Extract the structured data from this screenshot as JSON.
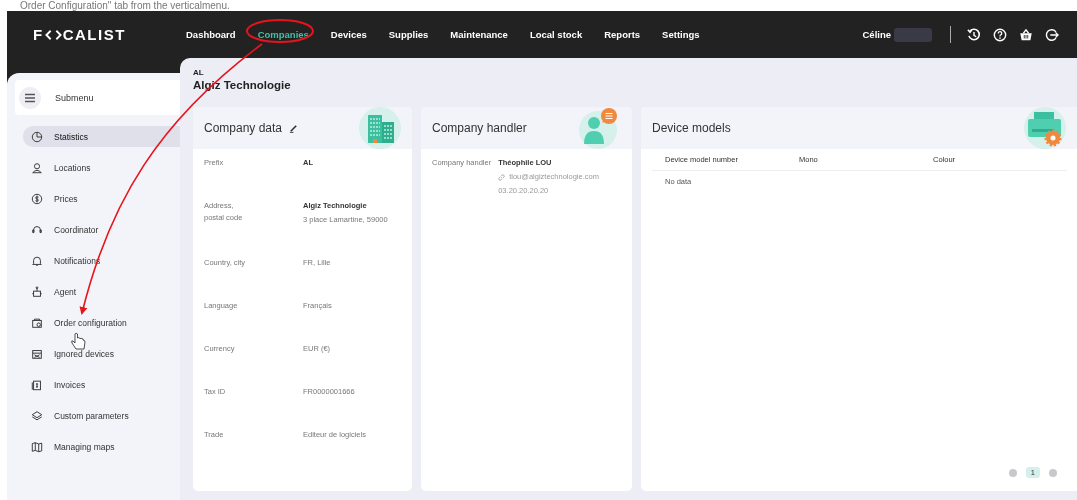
{
  "caption": "Order Configuration\" tab from the verticalmenu.",
  "topbar": {
    "logo_text": [
      "F",
      "CALIST"
    ],
    "nav": [
      {
        "label": "Dashboard",
        "selected": false
      },
      {
        "label": "Companies",
        "selected": true
      },
      {
        "label": "Devices",
        "selected": false
      },
      {
        "label": "Supplies",
        "selected": false
      },
      {
        "label": "Maintenance",
        "selected": false
      },
      {
        "label": "Local stock",
        "selected": false
      },
      {
        "label": "Reports",
        "selected": false
      },
      {
        "label": "Settings",
        "selected": false
      }
    ],
    "user": "Céline"
  },
  "sidebar": {
    "title": "Submenu",
    "items": [
      {
        "label": "Statistics",
        "selected": true
      },
      {
        "label": "Locations",
        "selected": false
      },
      {
        "label": "Prices",
        "selected": false
      },
      {
        "label": "Coordinator",
        "selected": false
      },
      {
        "label": "Notifications",
        "selected": false
      },
      {
        "label": "Agent",
        "selected": false
      },
      {
        "label": "Order configuration",
        "selected": false
      },
      {
        "label": "Ignored devices",
        "selected": false
      },
      {
        "label": "Invoices",
        "selected": false
      },
      {
        "label": "Custom parameters",
        "selected": false
      },
      {
        "label": "Managing maps",
        "selected": false
      }
    ]
  },
  "company": {
    "prefix": "AL",
    "name": "Algiz Technologie"
  },
  "company_data": {
    "title": "Company data",
    "rows": [
      {
        "label": "Prefix",
        "values": [
          {
            "text": "AL",
            "bold": true
          }
        ]
      },
      {
        "label": "Address,\npostal code",
        "values": [
          {
            "text": "Algiz Technologie",
            "bold": true
          },
          {
            "text": "3 place Lamartine, 59000",
            "bold": false
          }
        ]
      },
      {
        "label": "Country, city",
        "values": [
          {
            "text": "FR, Lille",
            "bold": false
          }
        ]
      },
      {
        "label": "Language",
        "values": [
          {
            "text": "Français",
            "bold": false
          }
        ]
      },
      {
        "label": "Currency",
        "values": [
          {
            "text": "EUR (€)",
            "bold": false
          }
        ]
      },
      {
        "label": "Tax ID",
        "values": [
          {
            "text": "FR0000001666",
            "bold": false
          }
        ]
      },
      {
        "label": "Trade",
        "values": [
          {
            "text": "Editeur de logiciels",
            "bold": false
          }
        ]
      }
    ]
  },
  "company_handler": {
    "title": "Company handler",
    "label": "Company handler",
    "name": "Théophile LOU",
    "email": "tlou@algiztechnologie.com",
    "phone": "03.20.20.20.20"
  },
  "device_models": {
    "title": "Device models",
    "columns": [
      "Device model number",
      "Mono",
      "Colour"
    ],
    "empty_text": "No data",
    "pages": [
      {
        "label": "1",
        "selected": true
      }
    ]
  }
}
